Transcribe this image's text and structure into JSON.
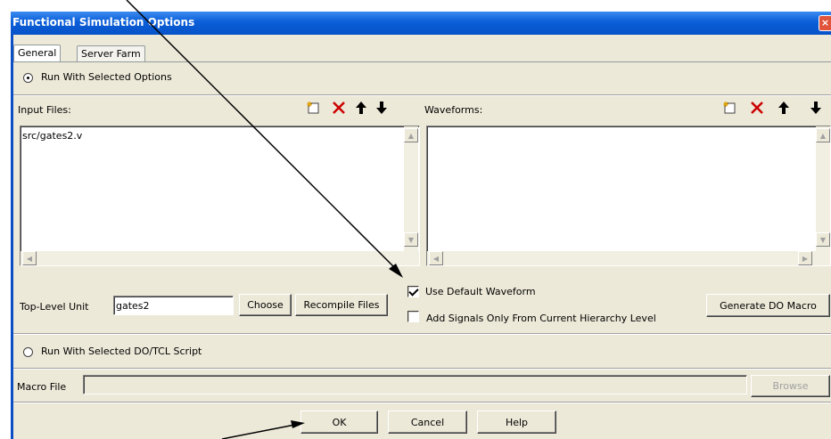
{
  "window": {
    "title": "Functional Simulation Options",
    "close_glyph": "×"
  },
  "tabs": [
    {
      "label": "General"
    },
    {
      "label": "Server Farm"
    }
  ],
  "run_selected_options": {
    "label": "Run With Selected Options",
    "selected": true
  },
  "input_files": {
    "label": "Input Files:",
    "items": [
      "src/gates2.v"
    ]
  },
  "waveforms": {
    "label": "Waveforms:",
    "items": []
  },
  "top_level": {
    "label": "Top-Level Unit",
    "value": "gates2",
    "choose": "Choose",
    "recompile": "Recompile Files"
  },
  "use_default_waveform": {
    "label": "Use Default Waveform",
    "checked": true
  },
  "add_signals": {
    "label": "Add Signals Only From Current Hierarchy Level",
    "checked": false
  },
  "generate_do": {
    "label": "Generate DO Macro"
  },
  "run_script": {
    "label": "Run With Selected DO/TCL Script",
    "selected": false
  },
  "macro_file": {
    "label": "Macro File",
    "value": "",
    "browse": "Browse"
  },
  "footer": {
    "ok": "OK",
    "cancel": "Cancel",
    "help": "Help"
  },
  "colors": {
    "title_bar": "#0a5ed8",
    "dialog_bg": "#ece9d8",
    "delete_icon": "#cc0000"
  }
}
